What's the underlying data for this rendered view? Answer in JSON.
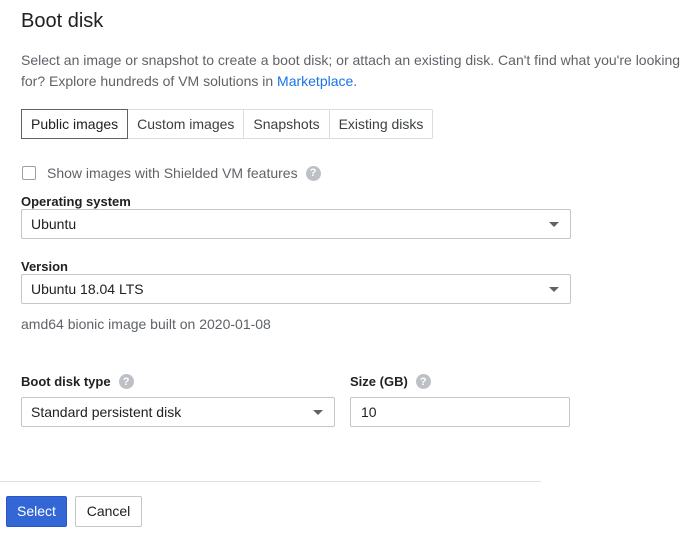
{
  "panel": {
    "title": "Boot disk",
    "description_prefix": "Select an image or snapshot to create a boot disk; or attach an existing disk. Can't find what you're looking for? Explore hundreds of VM solutions in ",
    "description_link": "Marketplace",
    "description_suffix": "."
  },
  "tabs": [
    {
      "label": "Public images",
      "active": true
    },
    {
      "label": "Custom images",
      "active": false
    },
    {
      "label": "Snapshots",
      "active": false
    },
    {
      "label": "Existing disks",
      "active": false
    }
  ],
  "shielded_checkbox": {
    "label": "Show images with Shielded VM features",
    "checked": false,
    "help_icon": "?"
  },
  "operating_system": {
    "label": "Operating system",
    "value": "Ubuntu"
  },
  "version": {
    "label": "Version",
    "value": "Ubuntu 18.04 LTS",
    "hint": "amd64 bionic image built on 2020-01-08"
  },
  "boot_disk_type": {
    "label": "Boot disk type",
    "value": "Standard persistent disk",
    "help_icon": "?"
  },
  "size": {
    "label": "Size (GB)",
    "value": "10",
    "help_icon": "?"
  },
  "actions": {
    "select_label": "Select",
    "cancel_label": "Cancel"
  }
}
